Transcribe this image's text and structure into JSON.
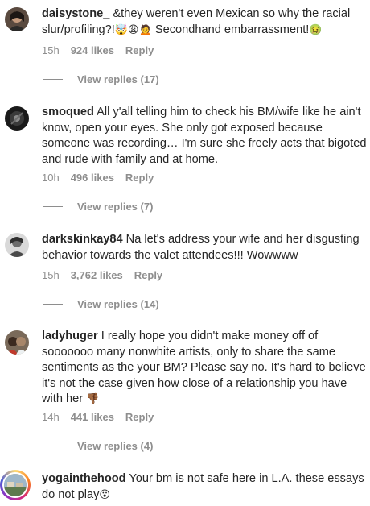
{
  "comments": [
    {
      "username": "daisystone_",
      "text": " &they weren't even Mexican so why the racial slur/profiling?!",
      "emoji_tail": "🤯😩🙍",
      "text2": " Secondhand embarrassment!",
      "emoji_end": "🤢",
      "time": "15h",
      "likes": "924 likes",
      "reply": "Reply",
      "view_replies": "View replies (17)"
    },
    {
      "username": "smoqued",
      "text": " All y'all telling him to check his BM/wife like he ain't know, open your eyes. She only got exposed because someone was recording… I'm sure she freely acts that bigoted and rude with family and at home.",
      "time": "10h",
      "likes": "496 likes",
      "reply": "Reply",
      "view_replies": "View replies (7)"
    },
    {
      "username": "darkskinkay84",
      "text": " Na let's address your wife and her disgusting behavior towards the valet attendees!!! Wowwww",
      "time": "15h",
      "likes": "3,762 likes",
      "reply": "Reply",
      "view_replies": "View replies (14)"
    },
    {
      "username": "ladyhuger",
      "text": " I really hope you didn't make money off of sooooooo many nonwhite artists, only to share the same sentiments as the your BM? Please say no. It's hard to believe it's not the case given how close of a relationship you have with her",
      "emoji_end": "👎🏾",
      "time": "14h",
      "likes": "441 likes",
      "reply": "Reply",
      "view_replies": "View replies (4)"
    },
    {
      "username": "yogainthehood",
      "text": " Your bm is not safe here in L.A. these essays do not play",
      "emoji_end": "😮"
    }
  ]
}
